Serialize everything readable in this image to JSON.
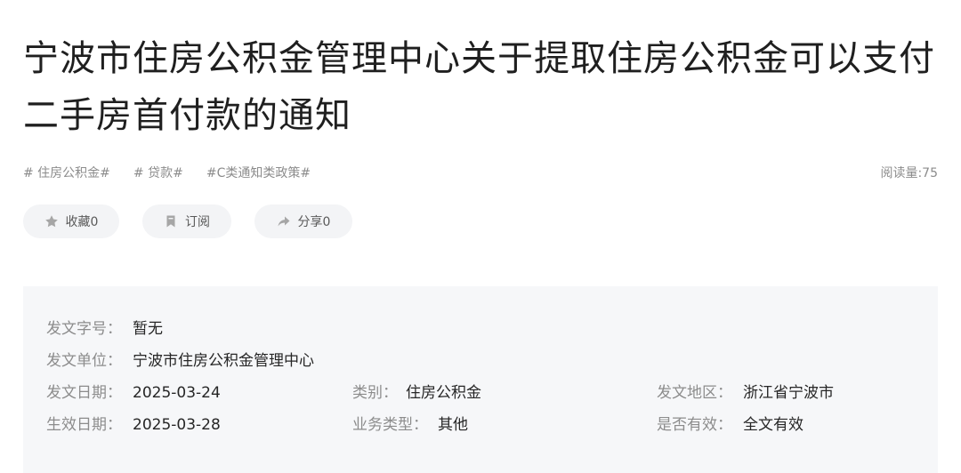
{
  "article": {
    "title": "宁波市住房公积金管理中心关于提取住房公积金可以支付二手房首付款的通知"
  },
  "tags": [
    "# 住房公积金#",
    "# 贷款#",
    "#C类通知类政策#"
  ],
  "views": "阅读量:75",
  "actions": {
    "favorite": "收藏0",
    "subscribe": "订阅",
    "share": "分享0"
  },
  "info": {
    "doc_no_label": "发文字号：",
    "doc_no": "暂无",
    "issuer_label": "发文单位：",
    "issuer": "宁波市住房公积金管理中心",
    "issue_date_label": "发文日期：",
    "issue_date": "2025-03-24",
    "category_label": "类别：",
    "category": "住房公积金",
    "region_label": "发文地区：",
    "region": "浙江省宁波市",
    "effective_date_label": "生效日期：",
    "effective_date": "2025-03-28",
    "biz_type_label": "业务类型：",
    "biz_type": "其他",
    "valid_label": "是否有效：",
    "valid": "全文有效"
  },
  "colors": {
    "title": "#1f1f1f",
    "muted": "#8c8c8c",
    "panel_bg": "#f6f7f9",
    "button_bg": "#f3f4f6"
  }
}
